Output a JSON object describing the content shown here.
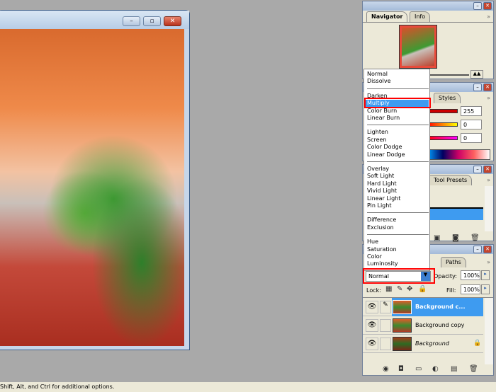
{
  "document": {
    "buttons": {
      "minimize": "–",
      "restore": "▫",
      "close": "✕"
    }
  },
  "navigator": {
    "tabs": [
      "Navigator",
      "Info"
    ],
    "more": "»"
  },
  "color": {
    "tab": "Styles",
    "values": [
      "255",
      "0",
      "0"
    ],
    "colors": {
      "r": "#ff0000",
      "g": "#ffff00",
      "b": "#ff00ff"
    }
  },
  "history": {
    "tab": "Tool Presets"
  },
  "layers": {
    "tab": "Paths",
    "blend_mode": "Normal",
    "opacity_label": "Opacity:",
    "opacity": "100%",
    "lock_label": "Lock:",
    "fill_label": "Fill:",
    "fill": "100%",
    "rows": [
      {
        "name": "Background c...",
        "selected": true
      },
      {
        "name": "Background copy"
      },
      {
        "name": "Background",
        "locked": true
      }
    ]
  },
  "blend_menu": {
    "groups": [
      [
        "Normal",
        "Dissolve"
      ],
      [
        "Darken",
        "Multiply",
        "Color Burn",
        "Linear Burn"
      ],
      [
        "Lighten",
        "Screen",
        "Color Dodge",
        "Linear Dodge"
      ],
      [
        "Overlay",
        "Soft Light",
        "Hard Light",
        "Vivid Light",
        "Linear Light",
        "Pin Light"
      ],
      [
        "Difference",
        "Exclusion"
      ],
      [
        "Hue",
        "Saturation",
        "Color",
        "Luminosity"
      ]
    ],
    "highlighted": "Multiply"
  },
  "status": "Shift, Alt, and Ctrl for additional options."
}
